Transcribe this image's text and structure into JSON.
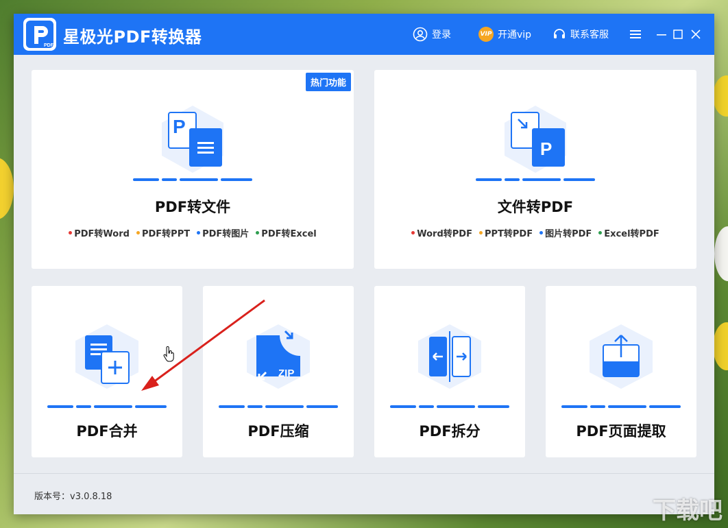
{
  "app": {
    "title": "星极光PDF转换器",
    "logo_text": "PDF"
  },
  "titlebar": {
    "login_label": "登录",
    "vip_badge": "VIP",
    "vip_label": "开通vip",
    "service_label": "联系客服"
  },
  "cards_big": [
    {
      "badge": "热门功能",
      "title": "PDF转文件",
      "subs": [
        {
          "label": "PDF转Word",
          "color": "#e53935"
        },
        {
          "label": "PDF转PPT",
          "color": "#f5a623"
        },
        {
          "label": "PDF转图片",
          "color": "#1e74f5"
        },
        {
          "label": "PDF转Excel",
          "color": "#2e9e4f"
        }
      ]
    },
    {
      "title": "文件转PDF",
      "subs": [
        {
          "label": "Word转PDF",
          "color": "#e53935"
        },
        {
          "label": "PPT转PDF",
          "color": "#f5a623"
        },
        {
          "label": "图片转PDF",
          "color": "#1e74f5"
        },
        {
          "label": "Excel转PDF",
          "color": "#2e9e4f"
        }
      ]
    }
  ],
  "cards_small": [
    {
      "title": "PDF合并",
      "icon": "merge-icon"
    },
    {
      "title": "PDF压缩",
      "icon": "compress-icon",
      "icon_text": "ZIP"
    },
    {
      "title": "PDF拆分",
      "icon": "split-icon"
    },
    {
      "title": "PDF页面提取",
      "icon": "extract-icon"
    }
  ],
  "footer": {
    "version": "版本号：v3.0.8.18"
  },
  "watermark": "下载吧",
  "colors": {
    "accent": "#1e74f5",
    "background": "#e9ecf1"
  }
}
